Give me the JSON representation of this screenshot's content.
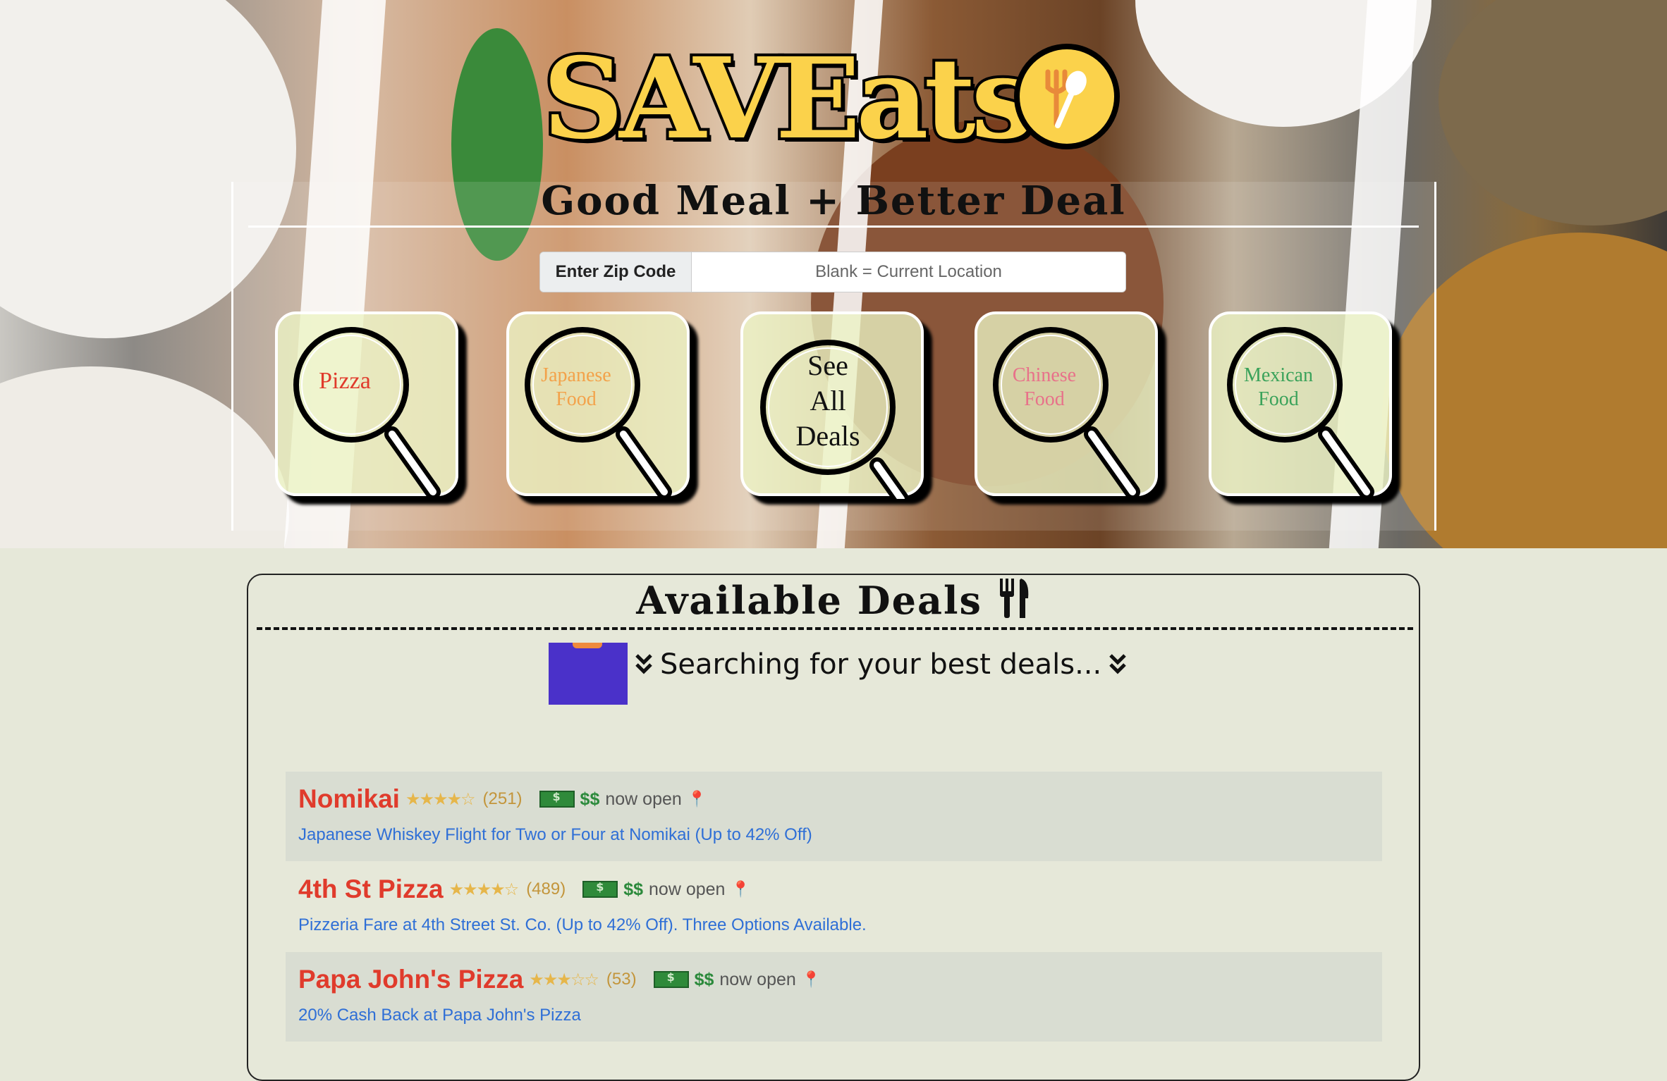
{
  "brand": {
    "logo_text": "SAVEats",
    "tagline": "Good Meal + Better Deal"
  },
  "search": {
    "zip_label": "Enter Zip Code",
    "zip_placeholder": "Blank = Current Location"
  },
  "categories": [
    {
      "label_line1": "Pizza",
      "label_line2": "",
      "label_line3": "",
      "color": "#e03b2c"
    },
    {
      "label_line1": "Japanese",
      "label_line2": "Food",
      "label_line3": "",
      "color": "#f3a24a"
    },
    {
      "label_line1": "See",
      "label_line2": "All",
      "label_line3": "Deals",
      "color": "#111111"
    },
    {
      "label_line1": "Chinese",
      "label_line2": "Food",
      "label_line3": "",
      "color": "#e8718a"
    },
    {
      "label_line1": "Mexican",
      "label_line2": "Food",
      "label_line3": "",
      "color": "#3aa25a"
    }
  ],
  "deals_section": {
    "title": "Available Deals",
    "searching_text": "Searching for your best deals..."
  },
  "deals": [
    {
      "name": "Nomikai",
      "stars": "★★★★☆",
      "rating": 4,
      "reviews": "(251)",
      "price": "$$",
      "status": "now open",
      "description": "Japanese Whiskey Flight for Two or Four at Nomikai (Up to 42% Off)"
    },
    {
      "name": "4th St Pizza",
      "stars": "★★★★☆",
      "rating": 3.5,
      "reviews": "(489)",
      "price": "$$",
      "status": "now open",
      "description": "Pizzeria Fare at 4th Street St. Co. (Up to 42% Off). Three Options Available."
    },
    {
      "name": "Papa John's Pizza",
      "stars": "★★★☆☆",
      "rating": 2.5,
      "reviews": "(53)",
      "price": "$$",
      "status": "now open",
      "description": "20% Cash Back at Papa John's Pizza"
    }
  ],
  "icons": {
    "logo_badge": "fork-spoon-icon",
    "title_icon": "utensils-icon",
    "chevrons": "chevron-double-down-icon",
    "bill": "money-bill-icon",
    "pin": "map-pin-icon",
    "category": "magnifier-icon"
  },
  "colors": {
    "brand_yellow": "#fbd24b",
    "deal_name": "#e03b2c",
    "deal_link": "#2f6fd6",
    "price": "#2c8a3c",
    "background": "#e6e8d9"
  }
}
